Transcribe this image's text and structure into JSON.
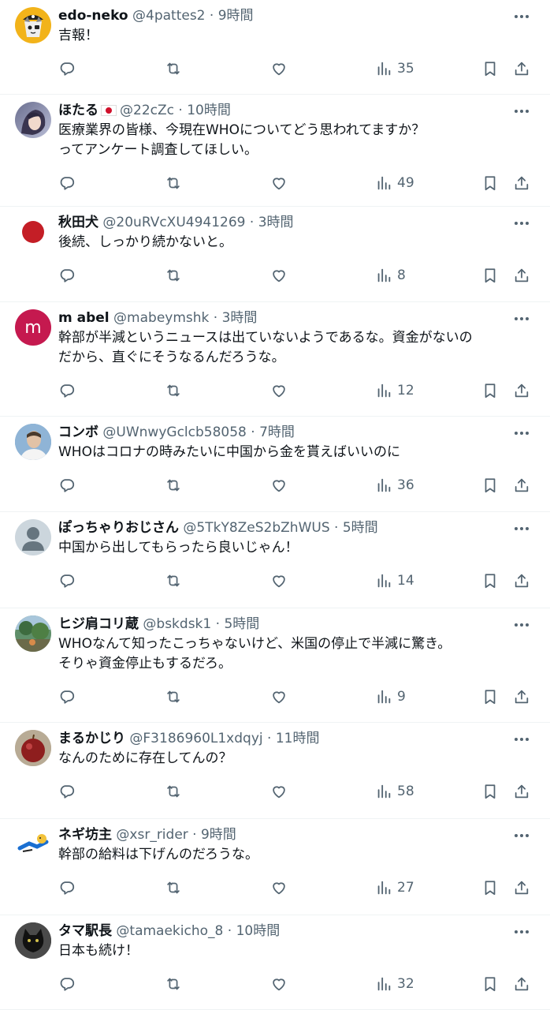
{
  "tweets": [
    {
      "name": "edo-neko",
      "handle": "@4pattes2",
      "time": "9時間",
      "text": "吉報！",
      "views": "35",
      "has_flag": false,
      "avatar": "pirate-cat"
    },
    {
      "name": "ほたる",
      "handle": "@22cZc",
      "time": "10時間",
      "text": "医療業界の皆様、今現在WHOについてどう思われてますか？\nってアンケート調査してほしい。",
      "views": "49",
      "has_flag": true,
      "avatar": "anime"
    },
    {
      "name": "秋田犬",
      "handle": "@20uRVcXU4941269",
      "time": "3時間",
      "text": "後続、しっかり続かないと。",
      "views": "8",
      "has_flag": false,
      "avatar": "red-dot"
    },
    {
      "name": "m abel",
      "handle": "@mabeymshk",
      "time": "3時間",
      "text": "幹部が半減というニュースは出ていないようであるな。資金がないの\nだから、直ぐにそうなるんだろうな。",
      "views": "12",
      "has_flag": false,
      "avatar": "letter-m"
    },
    {
      "name": "コンボ",
      "handle": "@UWnwyGclcb58058",
      "time": "7時間",
      "text": "WHOはコロナの時みたいに中国から金を貰えばいいのに",
      "views": "36",
      "has_flag": false,
      "avatar": "person-photo"
    },
    {
      "name": "ぽっちゃりおじさん",
      "handle": "@5TkY8ZeS2bZhWUS",
      "time": "5時間",
      "text": "中国から出してもらったら良いじゃん！",
      "views": "14",
      "has_flag": false,
      "avatar": "default"
    },
    {
      "name": "ヒジ肩コリ蔵",
      "handle": "@bskdsk1",
      "time": "5時間",
      "text": "WHOなんて知ったこっちゃないけど、米国の停止で半減に驚き。\nそりゃ資金停止もするだろ。",
      "views": "9",
      "has_flag": false,
      "avatar": "landscape"
    },
    {
      "name": "まるかじり",
      "handle": "@F3186960L1xdqyj",
      "time": "11時間",
      "text": "なんのために存在してんの？",
      "views": "58",
      "has_flag": false,
      "avatar": "apple"
    },
    {
      "name": "ネギ坊主",
      "handle": "@xsr_rider",
      "time": "9時間",
      "text": "幹部の給料は下げんのだろうな。",
      "views": "27",
      "has_flag": false,
      "avatar": "cartoon"
    },
    {
      "name": "タマ駅長",
      "handle": "@tamaekicho_8",
      "time": "10時間",
      "text": "日本も続け！",
      "views": "32",
      "has_flag": false,
      "avatar": "black-cat"
    }
  ],
  "avatar_letter": "m",
  "separator": " · ",
  "colors": {
    "text": "#0f1419",
    "secondary": "#536471",
    "divider": "#eff3f4",
    "avatar_m": "#c5194f",
    "red_dot": "#c41e26"
  }
}
